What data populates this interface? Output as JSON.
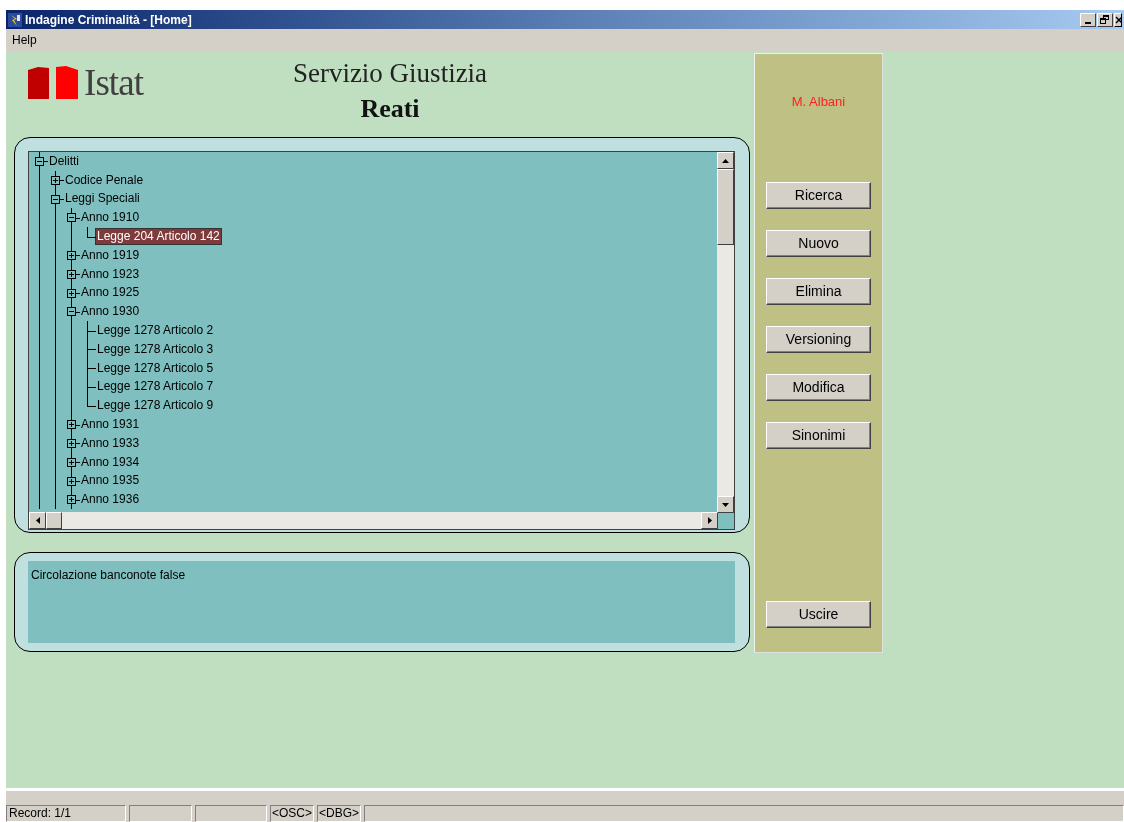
{
  "window": {
    "title": "Indagine Criminalità - [Home]"
  },
  "menu": [
    {
      "label": "Help"
    }
  ],
  "logo": {
    "text": "Istat"
  },
  "header": {
    "title": "Servizio Giustizia",
    "subtitle": "Reati"
  },
  "tree": [
    {
      "label": "Delitti",
      "expanded": true,
      "selected": false,
      "children": [
        {
          "label": "Codice Penale",
          "expanded": false,
          "selected": false
        },
        {
          "label": "Leggi Speciali",
          "expanded": true,
          "selected": false,
          "children": [
            {
              "label": "Anno 1910",
              "expanded": true,
              "selected": false,
              "children": [
                {
                  "label": "Legge 204 Articolo 142",
                  "selected": true
                }
              ]
            },
            {
              "label": "Anno 1919",
              "expanded": false,
              "selected": false
            },
            {
              "label": "Anno 1923",
              "expanded": false,
              "selected": false
            },
            {
              "label": "Anno 1925",
              "expanded": false,
              "selected": false
            },
            {
              "label": "Anno 1930",
              "expanded": true,
              "selected": false,
              "children": [
                {
                  "label": "Legge 1278 Articolo 2",
                  "selected": false
                },
                {
                  "label": "Legge 1278 Articolo 3",
                  "selected": false
                },
                {
                  "label": "Legge 1278 Articolo 5",
                  "selected": false
                },
                {
                  "label": "Legge 1278 Articolo 7",
                  "selected": false
                },
                {
                  "label": "Legge 1278 Articolo 9",
                  "selected": false
                }
              ]
            },
            {
              "label": "Anno 1931",
              "expanded": false,
              "selected": false
            },
            {
              "label": "Anno 1933",
              "expanded": false,
              "selected": false
            },
            {
              "label": "Anno 1934",
              "expanded": false,
              "selected": false
            },
            {
              "label": "Anno 1935",
              "expanded": false,
              "selected": false
            },
            {
              "label": "Anno 1936",
              "expanded": false,
              "selected": false
            }
          ]
        }
      ]
    }
  ],
  "description": "Circolazione banconote false",
  "user": "M. Albani",
  "buttons": [
    "Ricerca",
    "Nuovo",
    "Elimina",
    "Versioning",
    "Modifica",
    "Sinonimi"
  ],
  "exit_button": "Uscire",
  "status_bar": {
    "record": "Record: 1/1",
    "flags": [
      "<OSC>",
      "<DBG>"
    ]
  }
}
